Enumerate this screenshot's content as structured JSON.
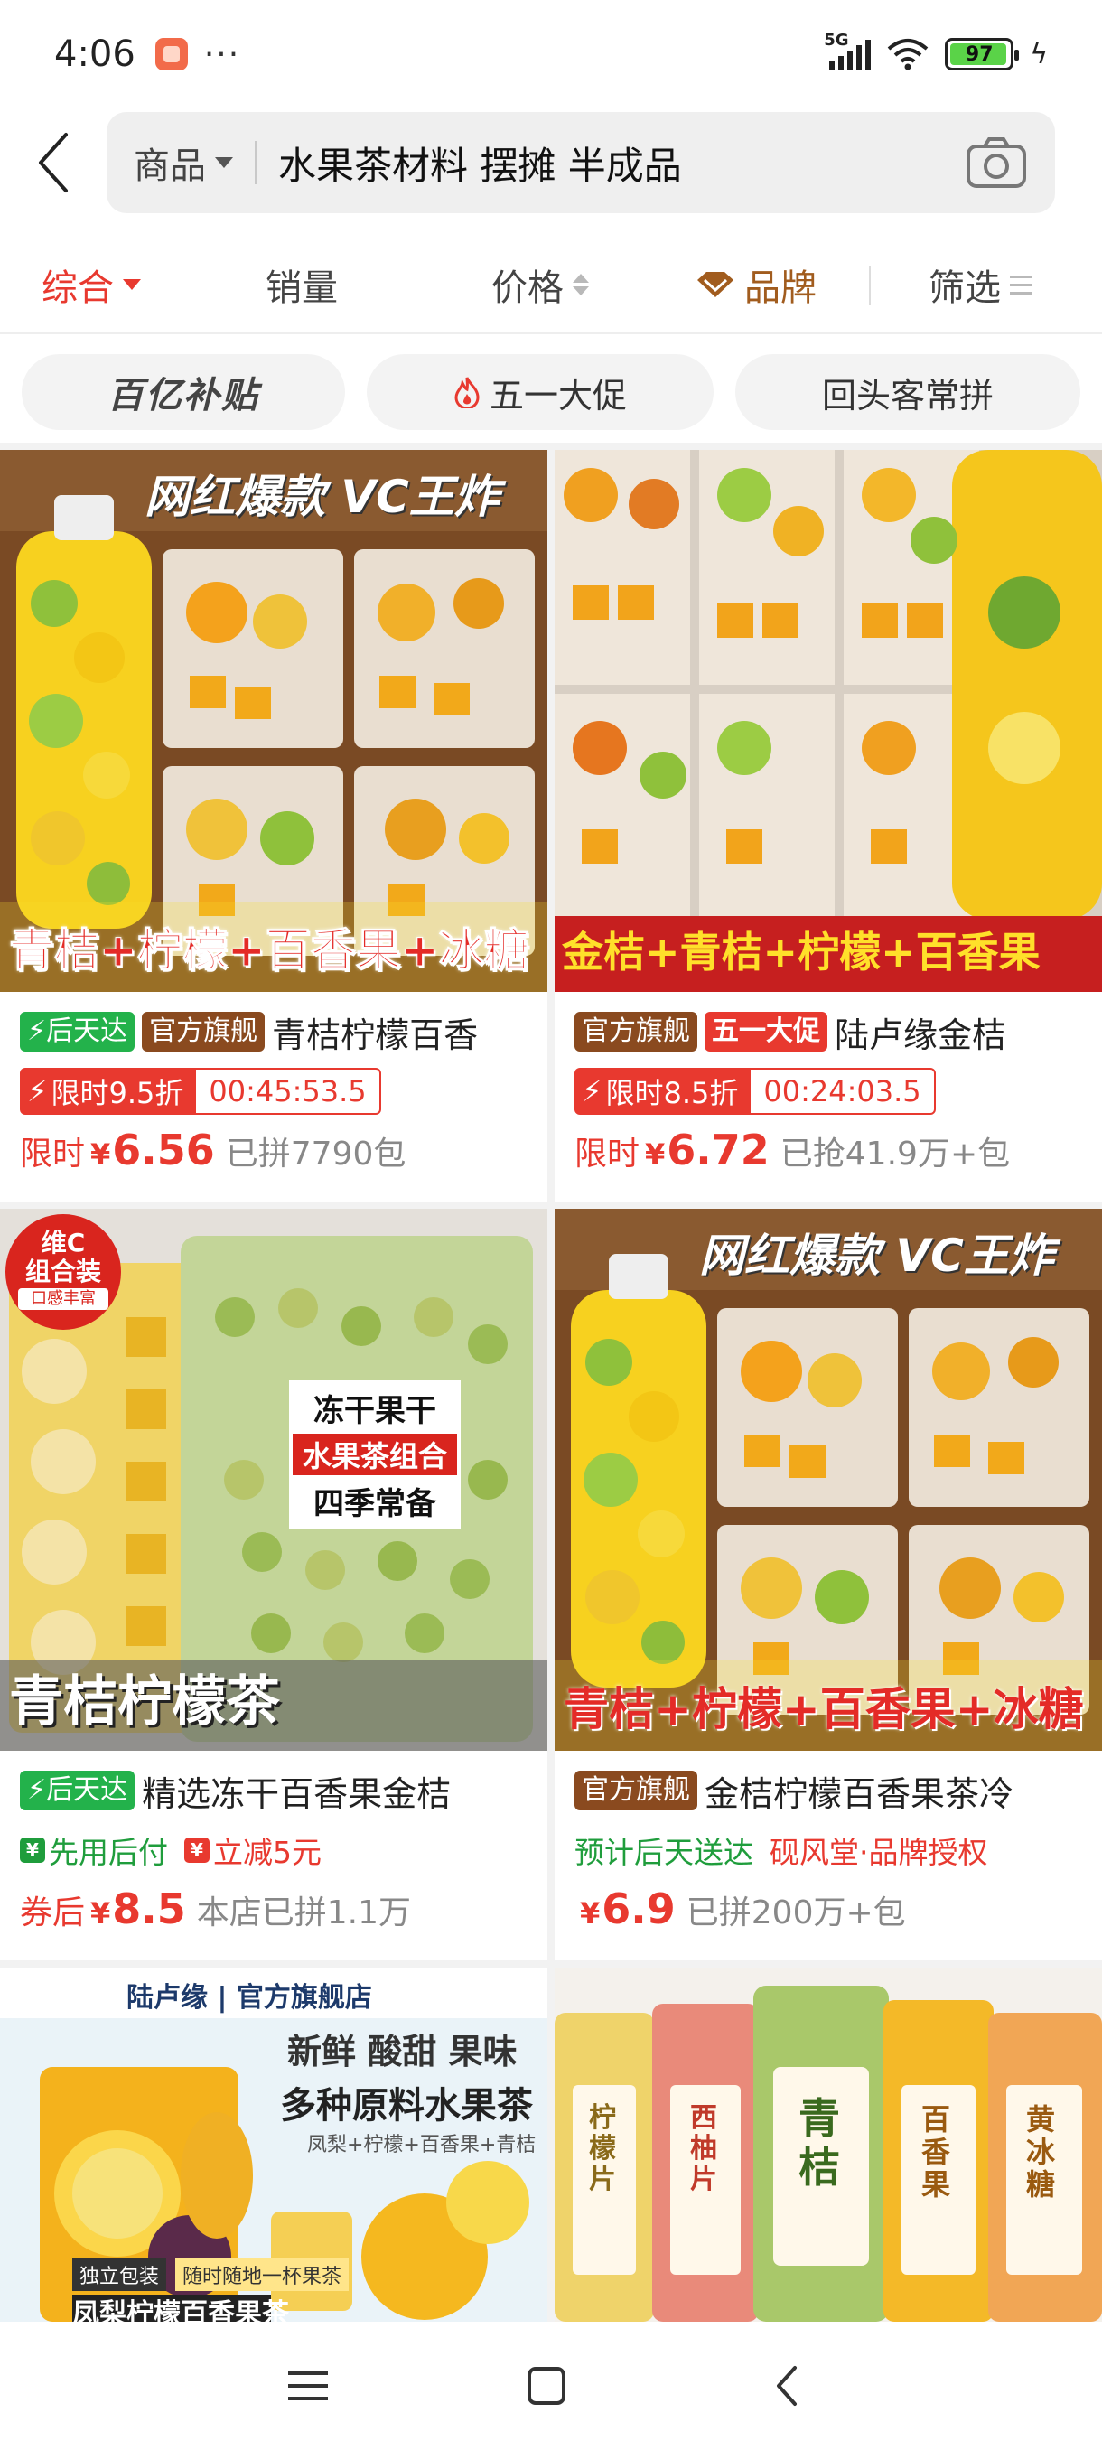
{
  "status_bar": {
    "time": "4:06",
    "network": "5G",
    "battery": "97"
  },
  "search": {
    "scope": "商品",
    "query": "水果茶材料 摆摊 半成品"
  },
  "sort": {
    "items": [
      "综合",
      "销量",
      "价格",
      "品牌",
      "筛选"
    ]
  },
  "promos": {
    "items": [
      "百亿补贴",
      "五一大促",
      "回头客常拼"
    ]
  },
  "products": [
    {
      "image": {
        "banner_top": "网红爆款 VC王炸",
        "banner_bottom": "青桔+柠檬+百香果+冰糖"
      },
      "badges": [
        "后天达",
        "官方旗舰"
      ],
      "title": "青桔柠檬百香",
      "flash": "限时9.5折",
      "countdown": "00:45:53.5",
      "price_label": "限时",
      "currency": "¥",
      "price": "6.56",
      "sold": "已拼7790包"
    },
    {
      "image": {
        "banner_top": "",
        "banner_bottom": "金桔+青桔+柠檬+百香果"
      },
      "badges": [
        "官方旗舰",
        "五一大促"
      ],
      "title": "陆卢缘金桔",
      "flash": "限时8.5折",
      "countdown": "00:24:03.5",
      "price_label": "限时",
      "currency": "¥",
      "price": "6.72",
      "sold": "已抢41.9万+包"
    },
    {
      "image": {
        "corner_badge": [
          "维C",
          "组合装",
          "口感丰富"
        ],
        "label_lines": [
          "冻干果干",
          "水果茶组合",
          "四季常备"
        ],
        "banner_bottom": "青桔柠檬茶"
      },
      "badges": [
        "后天达"
      ],
      "title": "精选冻干百香果金桔",
      "tags": [
        "先用后付",
        "立减5元"
      ],
      "price_label": "券后",
      "currency": "¥",
      "price": "8.5",
      "sold": "本店已拼1.1万"
    },
    {
      "image": {
        "banner_top": "网红爆款 VC王炸",
        "banner_bottom": "青桔+柠檬+百香果+冰糖"
      },
      "badges": [
        "官方旗舰"
      ],
      "title": "金桔柠檬百香果茶冷",
      "tags": [
        "预计后天送达",
        "砚风堂·品牌授权"
      ],
      "price_label": "",
      "currency": "¥",
      "price": "6.9",
      "sold": "已拼200万+包"
    },
    {
      "image": {
        "brand_header": "陆卢缘",
        "brand_suffix": "官方旗舰店",
        "headline": "新鲜 酸甜 果味",
        "subhead": "多种原料水果茶",
        "ingredients": "凤梨+柠檬+百香果+青桔",
        "pack_tag": "独立包装",
        "pack_tag2": "随时随地一杯果茶",
        "footer": "凤梨柠檬百香果茶"
      }
    },
    {
      "image": {
        "jars": [
          "柠檬片",
          "西柚片",
          "青桔",
          "百香果",
          "黄冰糖"
        ]
      }
    }
  ],
  "colors": {
    "accent_red": "#e8392f",
    "brand_brown": "#a15c1e",
    "green": "#23b24b"
  },
  "icons": [
    "back-arrow-icon",
    "camera-icon",
    "sort-arrow-icon",
    "diamond-icon",
    "filter-lines-icon",
    "flame-icon",
    "bolt-icon",
    "menu-icon",
    "home-icon",
    "nav-back-icon"
  ]
}
